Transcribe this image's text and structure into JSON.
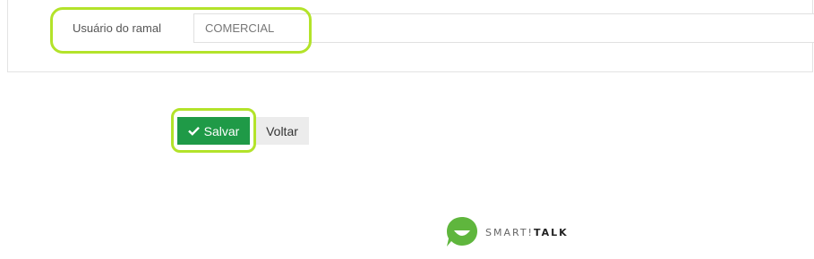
{
  "form": {
    "field_label": "Usuário do ramal",
    "field_value": "COMERCIAL"
  },
  "actions": {
    "save_label": "Salvar",
    "back_label": "Voltar"
  },
  "logo": {
    "text_regular": "SMART!",
    "text_bold": "TALK"
  },
  "colors": {
    "save_button": "#1f9a47",
    "highlight": "#b3e32a",
    "logo_green": "#5fb63d"
  },
  "icons": {
    "save_icon": "check-icon"
  }
}
